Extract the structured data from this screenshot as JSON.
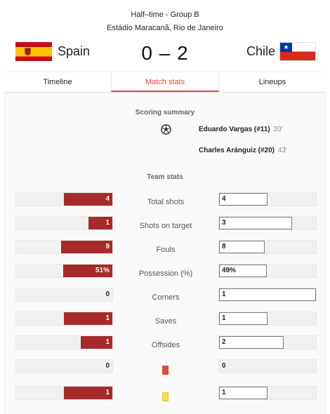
{
  "match": {
    "status": "Half–time - Group B",
    "venue": "Estádio Maracanã, Rio de Janeiro",
    "home_team": "Spain",
    "away_team": "Chile",
    "score": "0 – 2",
    "flag_colors": {
      "spain_red": "#c60b1e",
      "spain_yellow": "#ffc400",
      "chile_blue": "#0039a6",
      "chile_red": "#d52b1e"
    }
  },
  "tabs": [
    {
      "label": "Timeline",
      "active": false
    },
    {
      "label": "Match stats",
      "active": true
    },
    {
      "label": "Lineups",
      "active": false
    }
  ],
  "scoring_summary": {
    "title": "Scoring summary",
    "icon": "soccer-ball-icon",
    "goals": [
      {
        "scorer": "Eduardo Vargas (#11)",
        "minute": "20'"
      },
      {
        "scorer": "Charles Aránguiz (#20)",
        "minute": "43'"
      }
    ]
  },
  "team_stats": {
    "title": "Team stats",
    "colors": {
      "home_bar": "#a52a2a",
      "accent": "#dd4b39",
      "yellow_card": "#f4e04d"
    },
    "rows": [
      {
        "label": "Total shots",
        "home": "4",
        "away": "4",
        "home_frac": 0.5,
        "away_frac": 0.5
      },
      {
        "label": "Shots on target",
        "home": "1",
        "away": "3",
        "home_frac": 0.25,
        "away_frac": 0.75
      },
      {
        "label": "Fouls",
        "home": "9",
        "away": "8",
        "home_frac": 0.53,
        "away_frac": 0.47
      },
      {
        "label": "Possession (%)",
        "home": "51%",
        "away": "49%",
        "home_frac": 0.51,
        "away_frac": 0.49
      },
      {
        "label": "Corners",
        "home": "0",
        "away": "1",
        "home_frac": 0.0,
        "away_frac": 1.0
      },
      {
        "label": "Saves",
        "home": "1",
        "away": "1",
        "home_frac": 0.5,
        "away_frac": 0.5
      },
      {
        "label": "Offsides",
        "home": "1",
        "away": "2",
        "home_frac": 0.33,
        "away_frac": 0.67
      },
      {
        "label": "",
        "icon": "red-card-icon",
        "home": "0",
        "away": "0",
        "home_frac": 0.0,
        "away_frac": 0.0
      },
      {
        "label": "",
        "icon": "yellow-card-icon",
        "home": "1",
        "away": "1",
        "home_frac": 0.5,
        "away_frac": 0.5
      }
    ]
  }
}
